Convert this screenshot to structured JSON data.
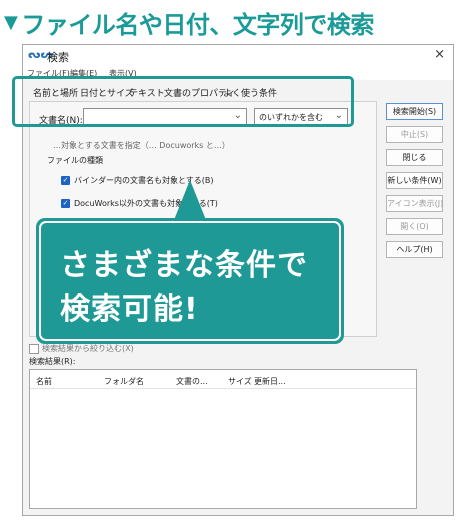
{
  "headline": {
    "marker": "▼",
    "text": "ファイル名や日付、文字列で検索"
  },
  "window": {
    "title": "検索",
    "app_icon": "docuworks-icon",
    "close_glyph": "×",
    "menu": [
      "ファイル(F)",
      "編集(E)",
      "表示(V)"
    ]
  },
  "tabs": [
    "名前と場所",
    "日付とサイズ",
    "テキスト",
    "文書のプロパティ",
    "よく使う条件"
  ],
  "name_field": {
    "label": "文書名(N):",
    "value": ""
  },
  "match_select": {
    "value": "のいずれかを含む"
  },
  "partial_text": "…対象とする文書を指定（… Docuworks と…）",
  "file_types": {
    "label": "ファイルの種類",
    "options": [
      {
        "label": "バインダー内の文書名も対象とする(B)",
        "checked": true
      },
      {
        "label": "DocuWorks以外の文書も対象とする(T)",
        "checked": true
      }
    ]
  },
  "buttons": [
    {
      "label": "検索開始(S)",
      "enabled": true
    },
    {
      "label": "中止(S)",
      "enabled": false
    },
    {
      "label": "閉じる",
      "enabled": true
    },
    {
      "label": "新しい条件(W)",
      "enabled": true
    },
    {
      "label": "アイコン表示(J)",
      "enabled": false
    },
    {
      "label": "開く(O)",
      "enabled": false
    },
    {
      "label": "ヘルプ(H)",
      "enabled": true
    }
  ],
  "refine": "検索結果から絞り込む(X)",
  "results": {
    "label": "検索結果(R):",
    "columns": [
      "名前",
      "フォルダ名",
      "文書の...",
      "サイズ",
      "更新日..."
    ]
  },
  "callout": {
    "line1": "さまざまな条件で",
    "line2": "検索可能!"
  },
  "colors": {
    "accent": "#1e9995",
    "headline": "#1a9b98",
    "checkbox": "#1f62c4"
  }
}
